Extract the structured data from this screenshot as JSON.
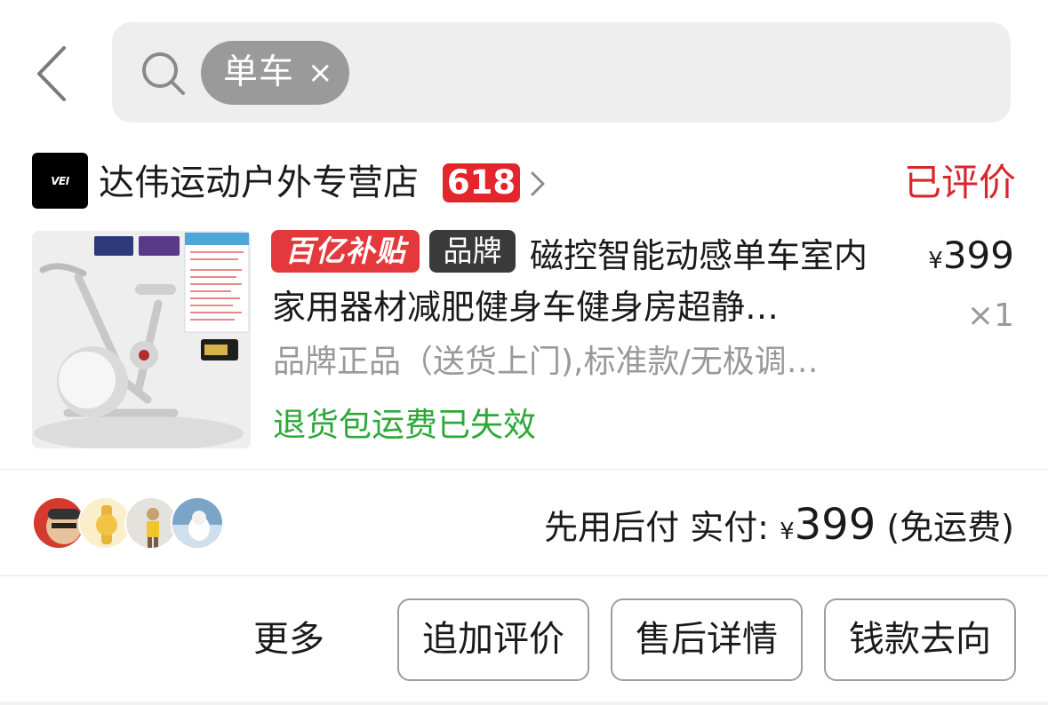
{
  "search": {
    "chip_label": "单车",
    "chip_close": "×"
  },
  "order": {
    "shop_logo_text": "VEI",
    "shop_name": "达伟运动户外专营店",
    "shop_badge": "618",
    "status": "已评价",
    "product": {
      "tag_subsidy": "百亿补贴",
      "tag_brand": "品牌",
      "title": "磁控智能动感单车室内家用器材减肥健身车健身房超静…",
      "price_symbol": "¥",
      "price": "399",
      "quantity": "×1",
      "sku": "品牌正品（送货上门),标准款/无极调…",
      "return_note": "退货包运费已失效"
    },
    "payment": {
      "label": "先用后付 实付:",
      "symbol": "¥",
      "amount": "399",
      "shipping_note": "(免运费)"
    }
  },
  "actions": {
    "more": "更多",
    "add_review": "追加评价",
    "after_sale": "售后详情",
    "money_flow": "钱款去向"
  },
  "colors": {
    "status_red": "#d9262c",
    "badge_red": "#e4262c",
    "return_green": "#2ea83a",
    "search_bg": "#eeeeee",
    "chip_bg": "#9a9a9a"
  }
}
